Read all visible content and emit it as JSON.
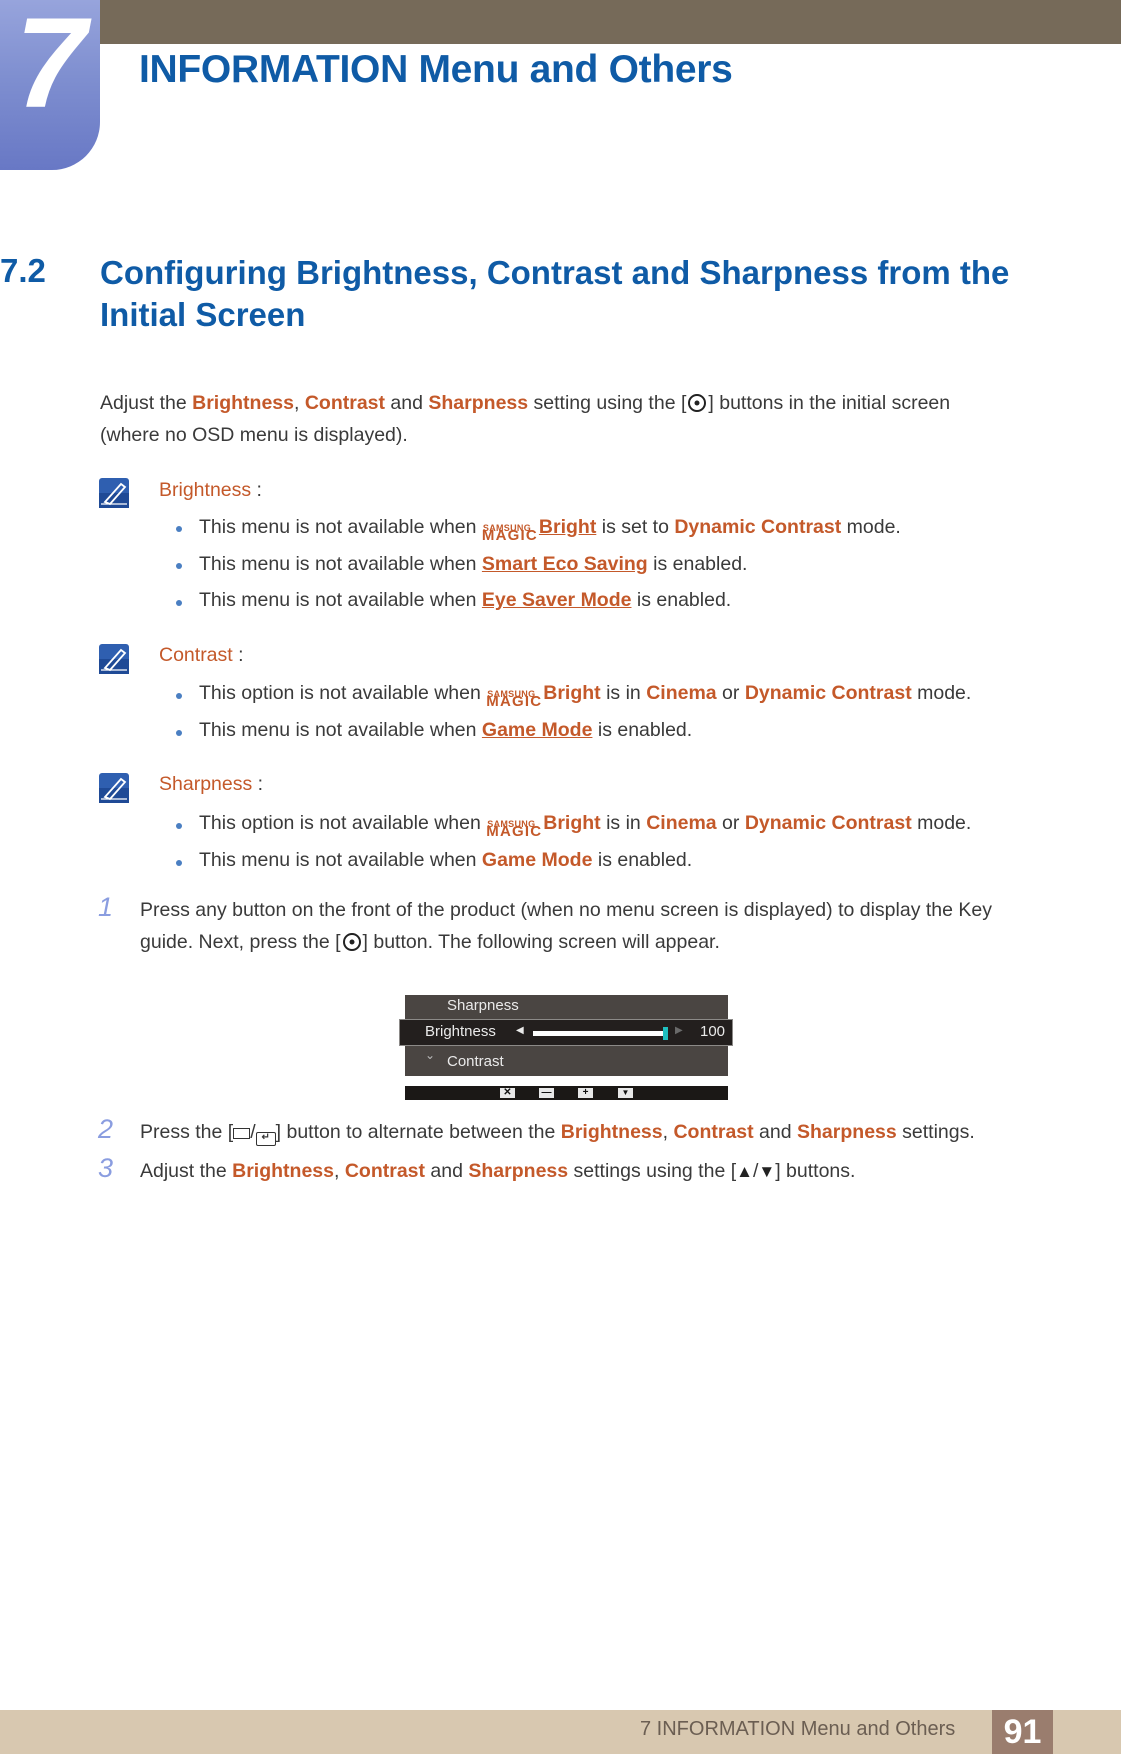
{
  "header": {
    "chapter_number": "7",
    "chapter_title": "INFORMATION Menu and Others"
  },
  "section": {
    "number": "7.2",
    "title": "Configuring Brightness, Contrast and Sharpness from the Initial Screen"
  },
  "intro": {
    "p1_a": "Adjust the ",
    "brightness": "Brightness",
    "comma": ", ",
    "contrast": "Contrast",
    "and": " and ",
    "sharpness": "Sharpness",
    "p1_b": " setting using the [",
    "p1_c": "] buttons in the initial screen",
    "line2": "(where no OSD menu is displayed)."
  },
  "magic_logo": {
    "top": "SAMSUNG",
    "bottom": "MAGIC"
  },
  "notes": [
    {
      "title": "Brightness",
      "colon": " :",
      "bullets": [
        {
          "pre": "This menu is not available when ",
          "link": "Bright",
          "mid": " is set to ",
          "hl": "Dynamic Contrast",
          "post": " mode."
        },
        {
          "pre": "This menu is not available when ",
          "link": "Smart Eco Saving",
          "post": " is enabled."
        },
        {
          "pre": "This menu is not available when ",
          "link": "Eye Saver Mode",
          "post": " is enabled."
        }
      ]
    },
    {
      "title": "Contrast",
      "colon": " :",
      "bullets": [
        {
          "pre": "This option is not available when ",
          "brand": "Bright",
          "mid": " is in ",
          "hl1": "Cinema",
          "or": " or ",
          "hl2": "Dynamic Contrast",
          "post": " mode."
        },
        {
          "pre": "This menu is not available when ",
          "link": "Game Mode",
          "post": " is enabled."
        }
      ]
    },
    {
      "title": "Sharpness",
      "colon": " :",
      "bullets": [
        {
          "pre": "This option is not available when ",
          "brand": "Bright",
          "mid": " is in ",
          "hl1": "Cinema",
          "or": " or ",
          "hl2": "Dynamic Contrast",
          "post": " mode."
        },
        {
          "pre": "This menu is not available when ",
          "hl": "Game Mode",
          "post": " is enabled."
        }
      ]
    }
  ],
  "steps": [
    {
      "num": "1",
      "line1": "Press any button on the front of the product (when no menu screen is displayed) to display the Key",
      "line2_a": "guide. Next, press the [",
      "line2_b": "] button. The following screen will appear."
    },
    {
      "num": "2",
      "a": "Press the [",
      "slash": "/",
      "b": "] button to alternate between the ",
      "brightness": "Brightness",
      "comma": ", ",
      "contrast": "Contrast",
      "and": " and ",
      "sharpness": "Sharpness",
      "c": " settings."
    },
    {
      "num": "3",
      "a": "Adjust the ",
      "brightness": "Brightness",
      "comma": ", ",
      "contrast": "Contrast",
      "and": " and ",
      "sharpness": "Sharpness",
      "b": " settings using the [",
      "up": "▲",
      "slash": "/",
      "down": "▼",
      "c": "] buttons."
    }
  ],
  "osd": {
    "item_above": "Sharpness",
    "selected_item": "Brightness",
    "item_below": "Contrast",
    "value": "100",
    "value_fraction": 1.0,
    "left_arrow": "◀",
    "right_arrow": "▶",
    "down_chevron": "⌄",
    "keys": [
      "✕",
      "—",
      "+",
      "▼"
    ],
    "accent_color": "#1fc0c0"
  },
  "footer": {
    "text": "7 INFORMATION Menu and Others",
    "page": "91"
  },
  "colors": {
    "heading_blue": "#0f5ba6",
    "highlight_orange": "#c4592a",
    "topbar_brown": "#766a59"
  }
}
